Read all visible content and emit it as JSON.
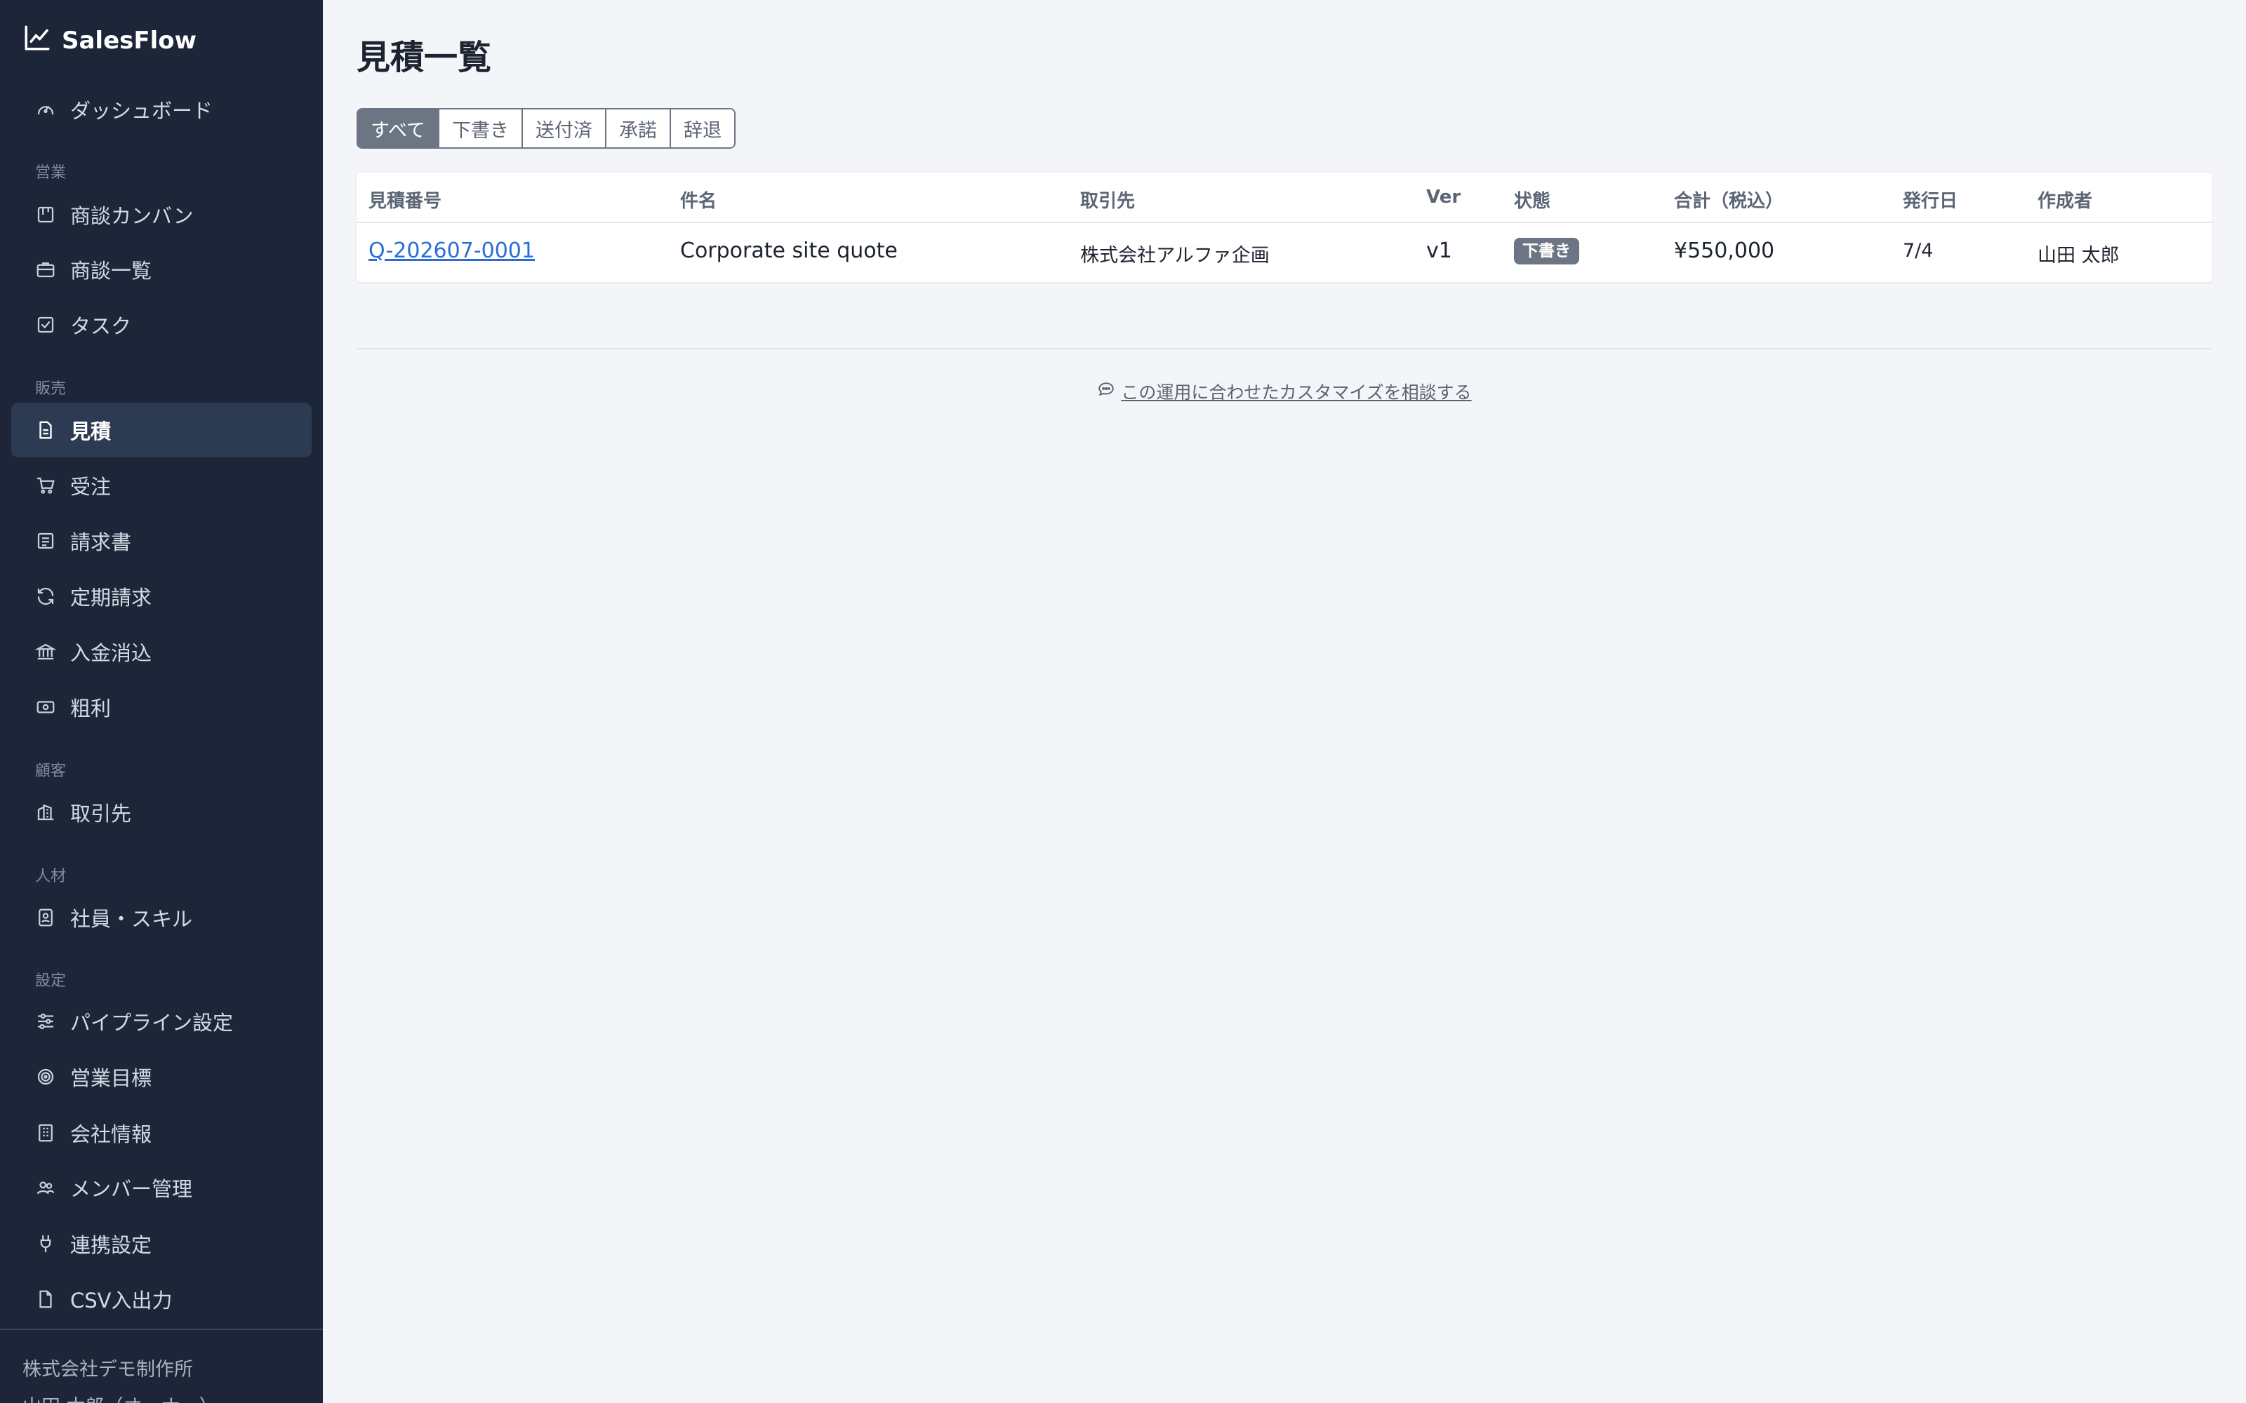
{
  "brand": {
    "name": "SalesFlow"
  },
  "sidebar": {
    "items": [
      {
        "label": "ダッシュボード"
      },
      {
        "section": "営業"
      },
      {
        "label": "商談カンバン"
      },
      {
        "label": "商談一覧"
      },
      {
        "label": "タスク"
      },
      {
        "section": "販売"
      },
      {
        "label": "見積",
        "active": true
      },
      {
        "label": "受注"
      },
      {
        "label": "請求書"
      },
      {
        "label": "定期請求"
      },
      {
        "label": "入金消込"
      },
      {
        "label": "粗利"
      },
      {
        "section": "顧客"
      },
      {
        "label": "取引先"
      },
      {
        "section": "人材"
      },
      {
        "label": "社員・スキル"
      },
      {
        "section": "設定"
      },
      {
        "label": "パイプライン設定"
      },
      {
        "label": "営業目標"
      },
      {
        "label": "会社情報"
      },
      {
        "label": "メンバー管理"
      },
      {
        "label": "連携設定"
      },
      {
        "label": "CSV入出力"
      }
    ],
    "footer": {
      "company": "株式会社デモ制作所",
      "user": "山田 太郎（オーナー）"
    }
  },
  "page": {
    "title": "見積一覧"
  },
  "filters": [
    {
      "label": "すべて",
      "active": true
    },
    {
      "label": "下書き"
    },
    {
      "label": "送付済"
    },
    {
      "label": "承諾"
    },
    {
      "label": "辞退"
    }
  ],
  "table": {
    "headers": [
      "見積番号",
      "件名",
      "取引先",
      "Ver",
      "状態",
      "合計（税込）",
      "発行日",
      "作成者"
    ],
    "rows": [
      {
        "number": "Q-202607-0001",
        "subject": "Corporate site quote",
        "client": "株式会社アルファ企画",
        "version": "v1",
        "status": "下書き",
        "total": "¥550,000",
        "issued": "7/4",
        "author": "山田 太郎"
      }
    ]
  },
  "consult": {
    "label": "この運用に合わせたカスタマイズを相談する"
  },
  "colors": {
    "sidebar_bg": "#1c2638",
    "active_bg": "#2c3a52",
    "link": "#2a6dd9",
    "badge": "#6c7584"
  }
}
